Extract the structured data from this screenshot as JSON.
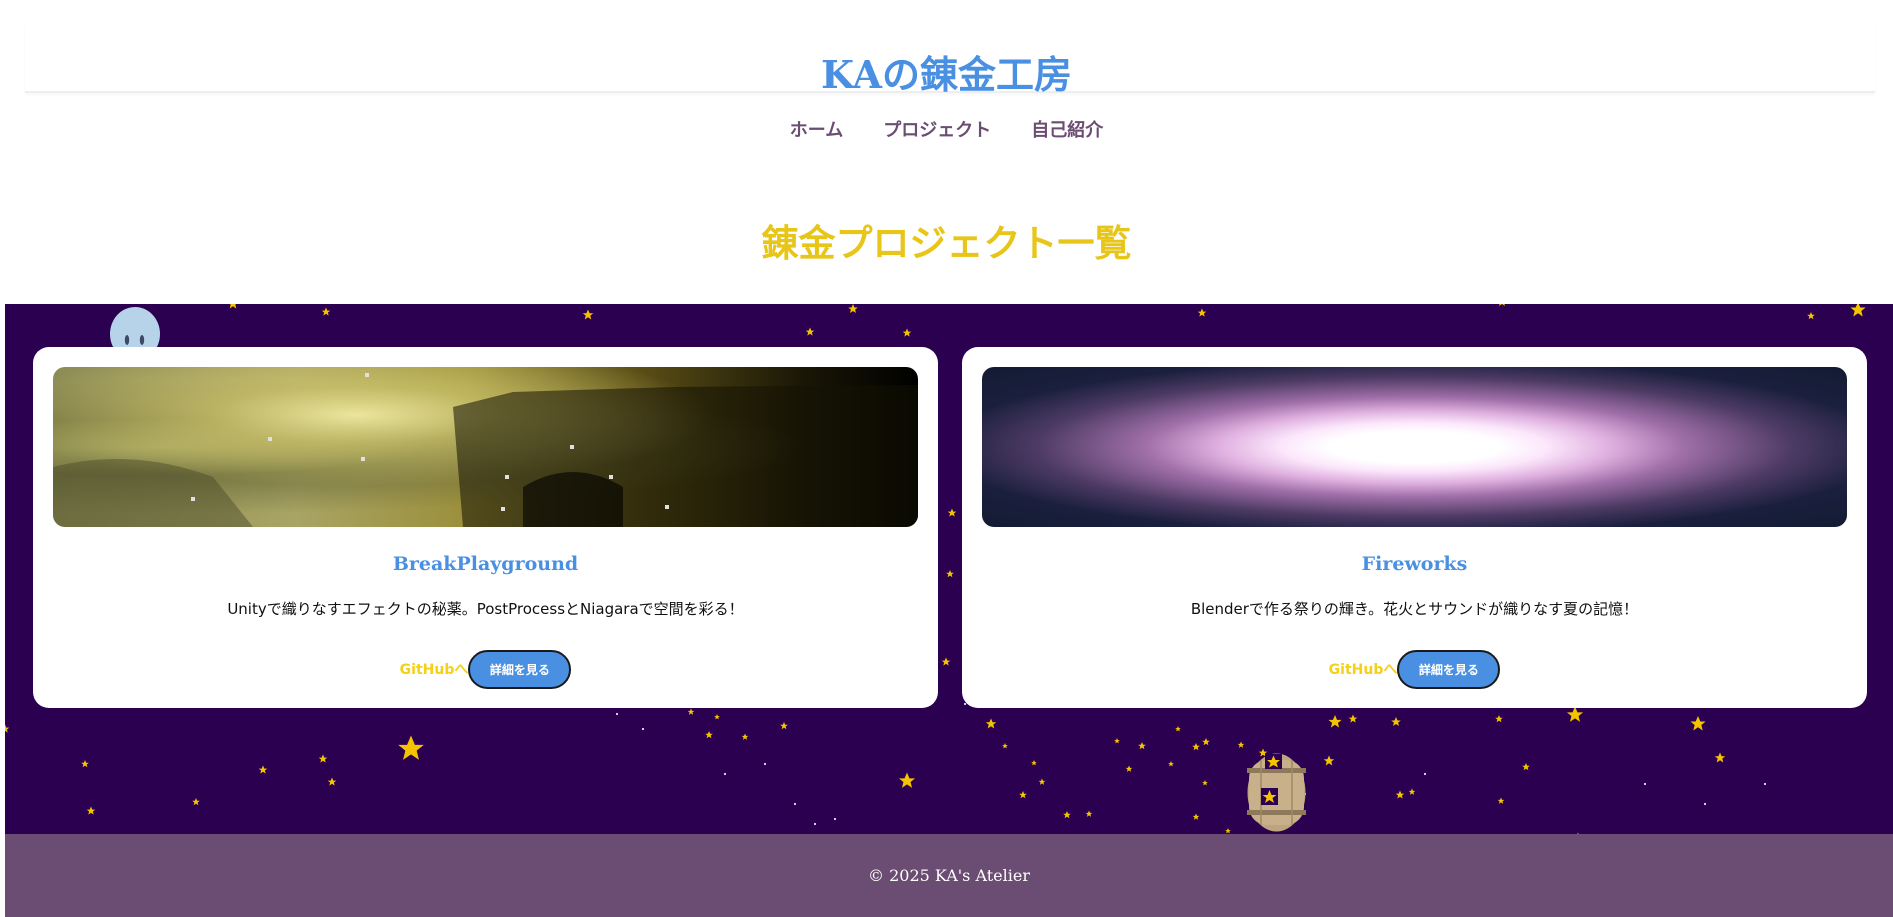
{
  "header": {
    "site_title": "KAの錬金工房",
    "nav": [
      {
        "label": "ホーム"
      },
      {
        "label": "プロジェクト"
      },
      {
        "label": "自己紹介"
      }
    ]
  },
  "main": {
    "heading": "錬金プロジェクト一覧",
    "projects": [
      {
        "title": "BreakPlayground",
        "description": "Unityで織りなすエフェクトの秘薬。PostProcessとNiagaraで空間を彩る！",
        "github_label": "GitHubへ",
        "detail_label": "詳細を見る"
      },
      {
        "title": "Fireworks",
        "description": "Blenderで作る祭りの輝き。花火とサウンドが織りなす夏の記憶！",
        "github_label": "GitHubへ",
        "detail_label": "詳細を見る"
      }
    ]
  },
  "footer": {
    "copyright": "© 2025 KA's Atelier"
  },
  "colors": {
    "accent_blue": "#4a90e2",
    "heading_gold": "#e8c619",
    "nav_purple": "#6b4c72",
    "sky": "#2b0050",
    "star": "#f5c400"
  },
  "icons": {
    "mascot": "ghost-icon",
    "barrel": "barrel-icon",
    "star": "star-icon"
  }
}
